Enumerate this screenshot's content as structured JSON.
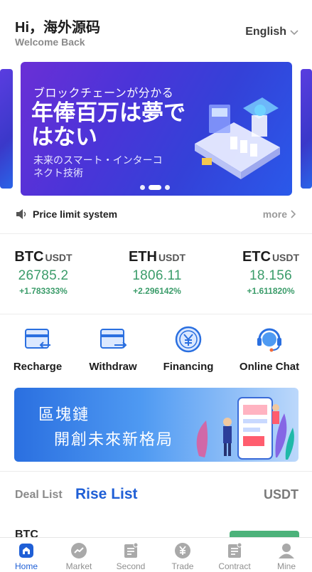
{
  "header": {
    "greeting": "Hi，海外源码",
    "welcome": "Welcome Back",
    "language": "English"
  },
  "banner": {
    "line1": "ブロックチェーンが分かる",
    "line2": "年俸百万は夢ではない",
    "line3": "未来のスマート・インターコネクト技術"
  },
  "notice": {
    "text": "Price limit system",
    "more": "more"
  },
  "tickers": [
    {
      "symbol": "BTC",
      "quote": "USDT",
      "price": "26785.2",
      "change": "+1.783333%"
    },
    {
      "symbol": "ETH",
      "quote": "USDT",
      "price": "1806.11",
      "change": "+2.296142%"
    },
    {
      "symbol": "ETC",
      "quote": "USDT",
      "price": "18.156",
      "change": "+1.611820%"
    }
  ],
  "actions": [
    {
      "label": "Recharge",
      "icon": "recharge-icon"
    },
    {
      "label": "Withdraw",
      "icon": "withdraw-icon"
    },
    {
      "label": "Financing",
      "icon": "financing-icon"
    },
    {
      "label": "Online Chat",
      "icon": "chat-icon"
    }
  ],
  "promo": {
    "line1": "區塊鏈",
    "line2": "開創未來新格局"
  },
  "list": {
    "tab_deal": "Deal List",
    "tab_rise": "Rise List",
    "quote": "USDT",
    "first_row_symbol": "BTC"
  },
  "bottom_nav": [
    {
      "label": "Home",
      "icon": "home-icon",
      "active": true
    },
    {
      "label": "Market",
      "icon": "market-icon",
      "active": false
    },
    {
      "label": "Second",
      "icon": "second-icon",
      "active": false
    },
    {
      "label": "Trade",
      "icon": "trade-icon",
      "active": false
    },
    {
      "label": "Contract",
      "icon": "contract-icon",
      "active": false
    },
    {
      "label": "Mine",
      "icon": "user-icon",
      "active": false
    }
  ],
  "colors": {
    "accent": "#1f5fd6",
    "up": "#3b9c6a",
    "muted": "#8a8a8a"
  }
}
